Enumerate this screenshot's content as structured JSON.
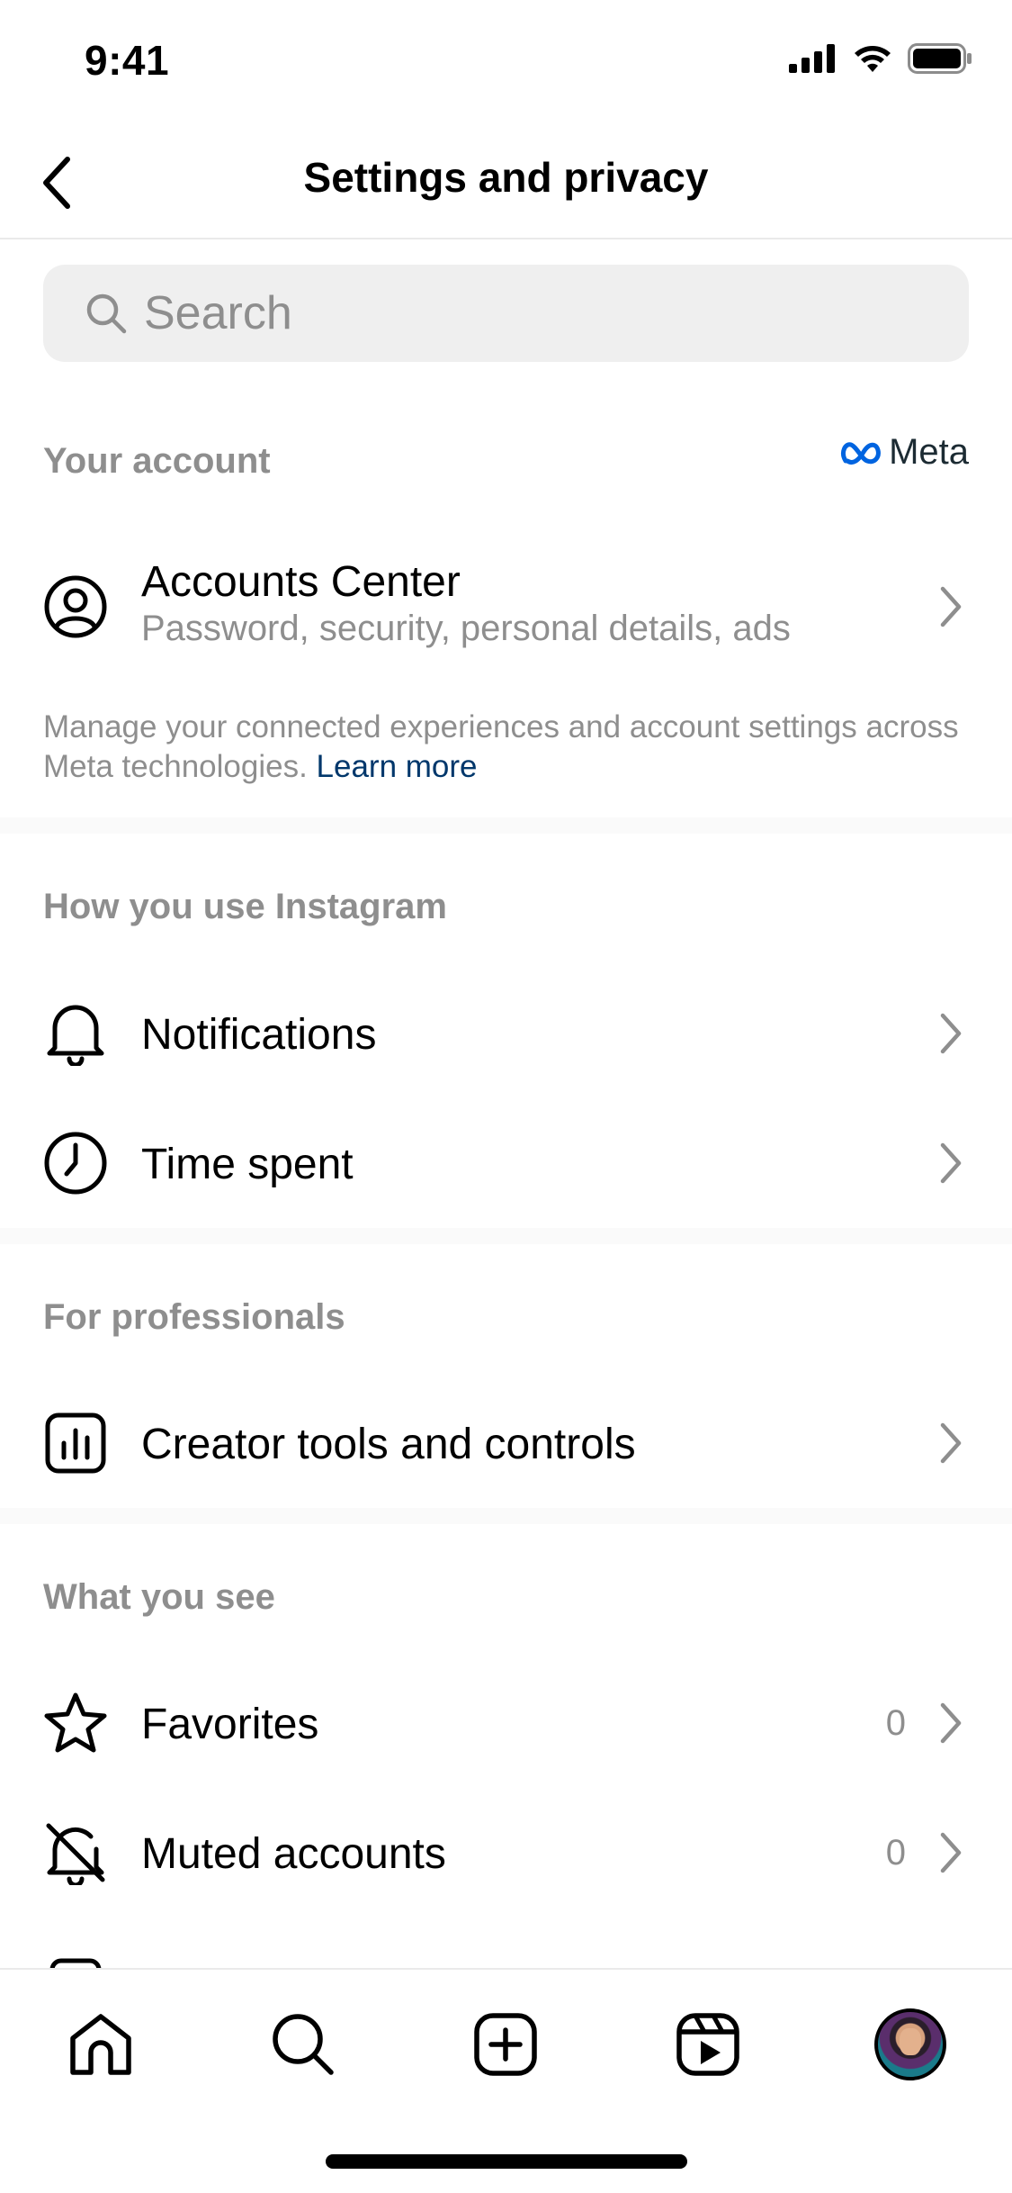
{
  "status_bar": {
    "time": "9:41"
  },
  "header": {
    "title": "Settings and privacy"
  },
  "search": {
    "placeholder": "Search"
  },
  "your_account": {
    "section_title": "Your account",
    "brand": "Meta",
    "accounts_center": {
      "label": "Accounts Center",
      "subtitle": "Password, security, personal details, ads"
    },
    "description": "Manage your connected experiences and account settings across Meta technologies.",
    "learn_more": "Learn more"
  },
  "how_you_use": {
    "section_title": "How you use Instagram",
    "items": [
      {
        "label": "Notifications",
        "icon": "bell-icon"
      },
      {
        "label": "Time spent",
        "icon": "clock-icon"
      }
    ]
  },
  "professionals": {
    "section_title": "For professionals",
    "items": [
      {
        "label": "Creator tools and controls",
        "icon": "bar-chart-icon"
      }
    ]
  },
  "what_you_see": {
    "section_title": "What you see",
    "items": [
      {
        "label": "Favorites",
        "count": "0",
        "icon": "star-icon"
      },
      {
        "label": "Muted accounts",
        "count": "0",
        "icon": "muted-bell-icon"
      }
    ]
  },
  "bottom_nav": {
    "items": [
      "home-icon",
      "search-icon",
      "create-icon",
      "reels-icon",
      "profile-avatar"
    ]
  },
  "colors": {
    "secondary_text": "#8e8e8e",
    "link": "#00376b",
    "meta_blue": "#0064e0",
    "search_bg": "#efefef"
  }
}
